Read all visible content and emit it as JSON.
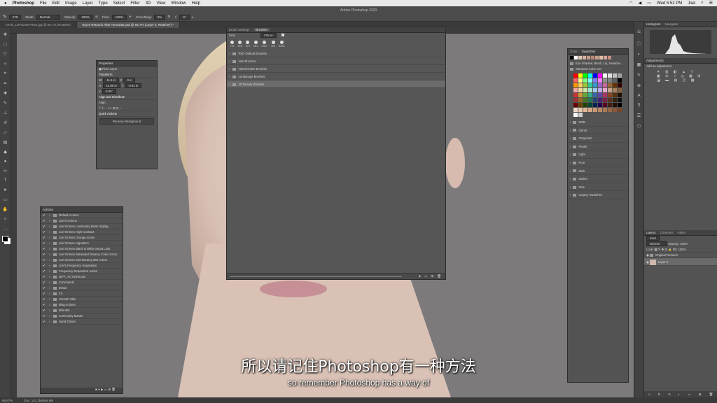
{
  "menubar": {
    "apple": "",
    "app": "Photoshop",
    "items": [
      "File",
      "Edit",
      "Image",
      "Layer",
      "Type",
      "Select",
      "Filter",
      "3D",
      "View",
      "Window",
      "Help"
    ],
    "clock": "Wed 5:52 PM",
    "user": "Joel"
  },
  "app_title": "Adobe Photoshop 2020",
  "options": {
    "mode_label": "Mode:",
    "mode": "Normal",
    "opacity_label": "Opacity:",
    "opacity": "100%",
    "flow_label": "Flow:",
    "flow": "100%",
    "smoothing_label": "Smoothing:",
    "smoothing": "0%",
    "angle": "0°",
    "brush_size": "175"
  },
  "tabs": [
    {
      "label": "Kevin_LRA6245-Paise.jpg @ 66.7% (RGB/8#)"
    },
    {
      "label": "Bryce Retouch After A2A6235.psd @ 66.7% (Layer 0, RGB/16*) *"
    }
  ],
  "status": {
    "zoom": "66.67%",
    "doc": "Doc: 141.3M/954.9M"
  },
  "properties": {
    "title": "Properties",
    "layer_type": "Pixel Layer",
    "transform": "Transform",
    "w_label": "W:",
    "w": "11.9 in",
    "x_label": "X:",
    "x": "0 in",
    "h_label": "H:",
    "h": "14.89 in",
    "y_label": "Y:",
    "y": "-0.91 in",
    "angle": "0.00°",
    "align": "Align and Distribute",
    "align_sub": "Align:",
    "quick_actions": "Quick Actions",
    "remove_bg": "Remove Background"
  },
  "actions": {
    "title": "Actions",
    "items": [
      "Default Actions",
      "Joel's Actions",
      "Joel Grimes Luminosity Mask Highlig...",
      "Joel Grimes High Contrast",
      "Joel Grimes Grunge Action",
      "Joel Grimes Vignette's",
      "Joel Grimes Black & White Sepia Look",
      "Joel Grimes Saturated Dreamy Color Action",
      "Joel Grimes Soft Dreamy BW Action",
      "Joel's Frequency Separation",
      "Frequency Separation Action",
      "DIFF_ACTIONS.atn",
      "Commands",
      "Detail",
      "FX",
      "Smooth Skin",
      "Blog Actions",
      "B/W-BN",
      "Luminosity Masks",
      "Hand Drawn"
    ]
  },
  "brushes": {
    "tab1": "Brush Settings",
    "tab2": "Brushes",
    "size_label": "Size:",
    "size": "175 px",
    "presets": [
      "175",
      "525",
      "471",
      "281",
      "2357",
      "400",
      "5264"
    ],
    "folders": [
      "PSD Default Brushes",
      "Hair Brushes",
      "Hand Drawn Brushes",
      "Landscape Brushes",
      "JG Beauty Brushes"
    ]
  },
  "swatches": {
    "tab1": "Color",
    "tab2": "Swatches",
    "recent_folder": "Eye Shadow, Blush, Lip, Swatche...",
    "standard": "Standard Color Set",
    "folders": [
      "RGB",
      "CMYK",
      "Grayscale",
      "Pastel",
      "Light",
      "Pure",
      "Dark",
      "Darker",
      "Pale",
      "Legacy Swatches"
    ]
  },
  "histogram": {
    "tab1": "Histogram",
    "tab2": "Navigator"
  },
  "adjustments": {
    "title": "Adjustments",
    "sub": "Add an adjustment"
  },
  "layers": {
    "tab1": "Layers",
    "tab2": "Channels",
    "tab3": "Paths",
    "kind": "Kind",
    "blend": "Normal",
    "opacity_label": "Opacity:",
    "opacity": "100%",
    "lock_label": "Lock:",
    "fill_label": "Fill:",
    "fill": "100%",
    "items": [
      "Original Retouch",
      "Layer 0"
    ]
  },
  "caption": {
    "zh": "所以请记住Photoshop有一种方法",
    "en": "so remember Photoshop has a way of"
  }
}
